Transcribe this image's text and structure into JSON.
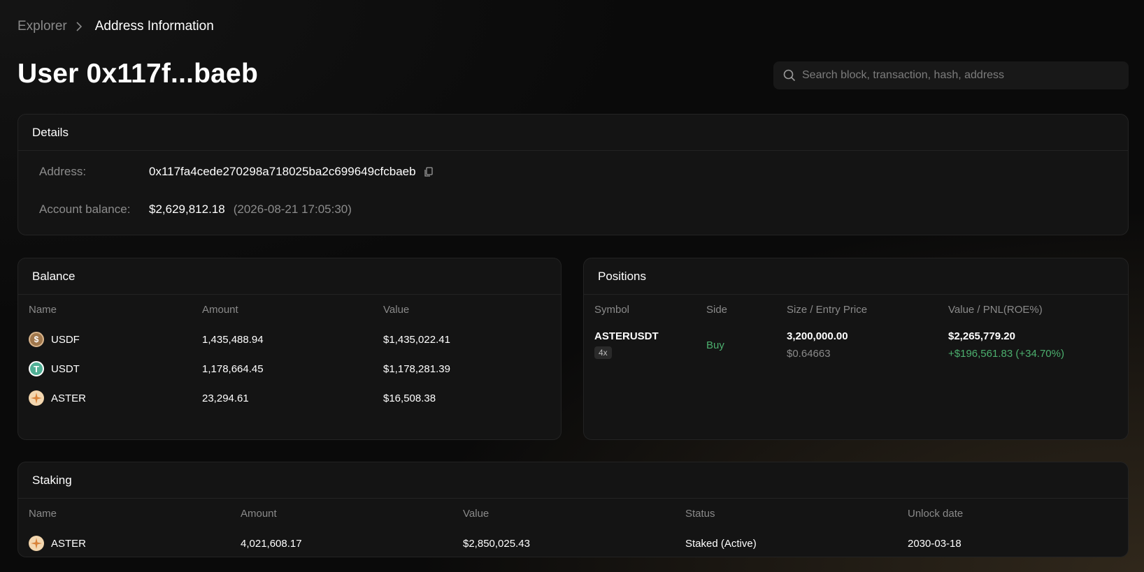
{
  "breadcrumb": {
    "root": "Explorer",
    "current": "Address Information"
  },
  "title": "User 0x117f...baeb",
  "search": {
    "placeholder": "Search block, transaction, hash, address"
  },
  "details": {
    "heading": "Details",
    "address_label": "Address:",
    "address": "0x117fa4cede270298a718025ba2c699649cfcbaeb",
    "balance_label": "Account balance:",
    "balance": "$2,629,812.18",
    "balance_time": "(2026-08-21 17:05:30)"
  },
  "balance": {
    "heading": "Balance",
    "columns": [
      "Name",
      "Amount",
      "Value"
    ],
    "rows": [
      {
        "icon": "usdf-coin-icon",
        "name": "USDF",
        "amount": "1,435,488.94",
        "value": "$1,435,022.41"
      },
      {
        "icon": "usdt-coin-icon",
        "name": "USDT",
        "amount": "1,178,664.45",
        "value": "$1,178,281.39"
      },
      {
        "icon": "aster-coin-icon",
        "name": "ASTER",
        "amount": "23,294.61",
        "value": "$16,508.38"
      }
    ]
  },
  "positions": {
    "heading": "Positions",
    "columns": [
      "Symbol",
      "Side",
      "Size / Entry Price",
      "Value / PNL(ROE%)"
    ],
    "rows": [
      {
        "symbol": "ASTERUSDT",
        "leverage": "4x",
        "side": "Buy",
        "size": "3,200,000.00",
        "entry_price": "$0.64663",
        "value": "$2,265,779.20",
        "pnl": "+$196,561.83 (+34.70%)"
      }
    ]
  },
  "staking": {
    "heading": "Staking",
    "columns": [
      "Name",
      "Amount",
      "Value",
      "Status",
      "Unlock date"
    ],
    "rows": [
      {
        "icon": "aster-coin-icon",
        "name": "ASTER",
        "amount": "4,021,608.17",
        "value": "$2,850,025.43",
        "status": "Staked (Active)",
        "unlock": "2030-03-18"
      }
    ]
  },
  "colors": {
    "accent_green": "#4caf6e",
    "card_bg": "#141414",
    "page_bg": "#0a0a0a"
  }
}
